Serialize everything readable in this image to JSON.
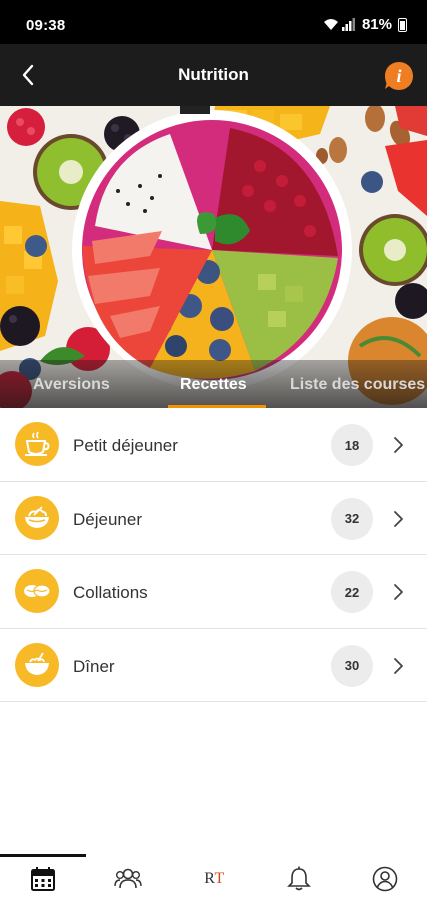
{
  "status_bar": {
    "time": "09:38",
    "battery": "81%"
  },
  "header": {
    "title": "Nutrition",
    "info_label": "i"
  },
  "tabs": [
    {
      "label": "Aversions",
      "active": false
    },
    {
      "label": "Recettes",
      "active": true
    },
    {
      "label": "Liste des courses",
      "active": false
    }
  ],
  "meals": [
    {
      "label": "Petit déjeuner",
      "count": "18",
      "icon": "coffee-cup-icon"
    },
    {
      "label": "Déjeuner",
      "count": "32",
      "icon": "meal-bowl-icon"
    },
    {
      "label": "Collations",
      "count": "22",
      "icon": "snack-icon"
    },
    {
      "label": "Dîner",
      "count": "30",
      "icon": "dinner-bowl-icon"
    }
  ],
  "bottom_nav": {
    "items": [
      "calendar-icon",
      "group-icon",
      "rt-logo",
      "bell-icon",
      "profile-icon"
    ],
    "rt_label_r": "R",
    "rt_label_t": "T",
    "active_index": 0
  },
  "colors": {
    "accent": "#f39200",
    "meal_icon_bg": "#f7b925",
    "header_bg": "#1c1c1c",
    "badge_bg": "#ececec"
  }
}
